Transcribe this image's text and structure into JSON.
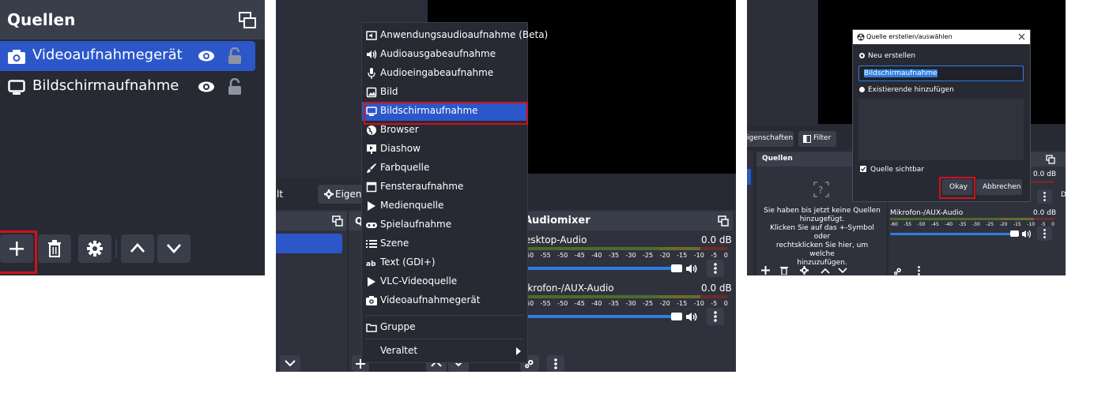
{
  "panel1": {
    "title": "Quellen",
    "sources": [
      {
        "label": "Videoaufnahmegerät",
        "icon": "camera-icon",
        "selected": true
      },
      {
        "label": "Bildschirmaufnahme",
        "icon": "monitor-icon",
        "selected": false
      }
    ],
    "toolbar": [
      "add-icon",
      "trash-icon",
      "gear-icon",
      "chevron-up-icon",
      "chevron-down-icon"
    ],
    "highlight_color": "#d0111b"
  },
  "panel2": {
    "menu": [
      {
        "label": "Anwendungsaudioaufnahme (Beta)",
        "icon": "app-audio-icon"
      },
      {
        "label": "Audioausgabeaufnahme",
        "icon": "speaker-icon"
      },
      {
        "label": "Audioeingabeaufnahme",
        "icon": "microphone-icon"
      },
      {
        "label": "Bild",
        "icon": "image-icon"
      },
      {
        "label": "Bildschirmaufnahme",
        "icon": "monitor-icon",
        "highlighted": true
      },
      {
        "label": "Browser",
        "icon": "globe-icon"
      },
      {
        "label": "Diashow",
        "icon": "slideshow-icon"
      },
      {
        "label": "Farbquelle",
        "icon": "brush-icon"
      },
      {
        "label": "Fensteraufnahme",
        "icon": "window-icon"
      },
      {
        "label": "Medienquelle",
        "icon": "play-icon"
      },
      {
        "label": "Spielaufnahme",
        "icon": "gamepad-icon"
      },
      {
        "label": "Szene",
        "icon": "list-icon"
      },
      {
        "label": "Text (GDI+)",
        "icon": "text-icon"
      },
      {
        "label": "VLC-Videoquelle",
        "icon": "play-icon"
      },
      {
        "label": "Videoaufnahmegerät",
        "icon": "camera-icon"
      }
    ],
    "menu_group": {
      "label": "Gruppe",
      "icon": "folder-icon"
    },
    "menu_deprecated": {
      "label": "Veraltet",
      "icon": "chevron-right-icon"
    },
    "left_tab_partial": "lt",
    "properties_partial": "Eigens",
    "quellen_partial": "Q",
    "mixer": {
      "title": "Audiomixer",
      "ticks": [
        "60",
        "-55",
        "-50",
        "-45",
        "-40",
        "-35",
        "-30",
        "-25",
        "-20",
        "-15",
        "-10",
        "-5",
        "0"
      ],
      "channels": [
        {
          "name": "esktop-Audio",
          "level": "0.0 dB",
          "volume": 1.0
        },
        {
          "name": "ikrofon-/AUX-Audio",
          "level": "0.0 dB",
          "volume": 1.0
        }
      ]
    }
  },
  "panel3": {
    "tabs": {
      "properties": "igenschaften",
      "filter": "Filter"
    },
    "quellen_title": "Quellen",
    "empty_text": [
      "Sie haben bis jetzt keine Quellen",
      "hinzugefügt.",
      "Klicken Sie auf das +-Symbol oder",
      "rechtsklicken Sie hier, um welche",
      "hinzuzufügen."
    ],
    "dialog": {
      "title": "Quelle erstellen/auswählen",
      "option_new": "Neu erstellen",
      "name_value": "Bildschirmaufnahme",
      "option_existing": "Existierende hinzufügen",
      "checkbox_label": "Quelle sichtbar",
      "checkbox_checked": true,
      "ok_label": "Okay",
      "cancel_label": "Abbrechen"
    },
    "mixer_channel": {
      "name": "Mikrofon-/AUX-Audio",
      "level": "0.0 dB"
    },
    "top_level": "0.0 dB",
    "ticks": [
      "-60",
      "-55",
      "-50",
      "-45",
      "-40",
      "-35",
      "-30",
      "-25",
      "-20",
      "-15",
      "-10",
      "-5",
      "0"
    ],
    "partial_letter": "D"
  }
}
